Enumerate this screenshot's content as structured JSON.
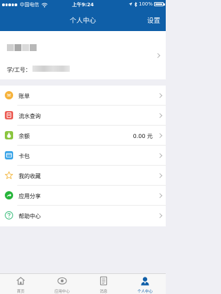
{
  "status_bar": {
    "carrier": "中国电信",
    "time": "上午9:24",
    "battery": "100%",
    "battery_level": 1.0
  },
  "nav": {
    "title": "个人中心",
    "settings_label": "设置"
  },
  "profile": {
    "id_label": "学/工号："
  },
  "menu": {
    "items": [
      {
        "label": "账单",
        "icon": "bill-icon"
      },
      {
        "label": "流水查询",
        "icon": "transactions-icon"
      },
      {
        "label": "余额",
        "icon": "balance-icon",
        "value": "0.00 元"
      },
      {
        "label": "卡包",
        "icon": "card-wallet-icon"
      },
      {
        "label": "我的收藏",
        "icon": "star-icon"
      },
      {
        "label": "应用分享",
        "icon": "share-icon"
      },
      {
        "label": "帮助中心",
        "icon": "help-icon"
      }
    ]
  },
  "tabs": [
    {
      "label": "首页",
      "icon": "home-icon"
    },
    {
      "label": "应用中心",
      "icon": "app-center-icon"
    },
    {
      "label": "消息",
      "icon": "message-icon"
    },
    {
      "label": "个人中心",
      "icon": "user-icon",
      "active": true
    }
  ],
  "colors": {
    "primary": "#0f5fa8",
    "background": "#efeff4"
  }
}
